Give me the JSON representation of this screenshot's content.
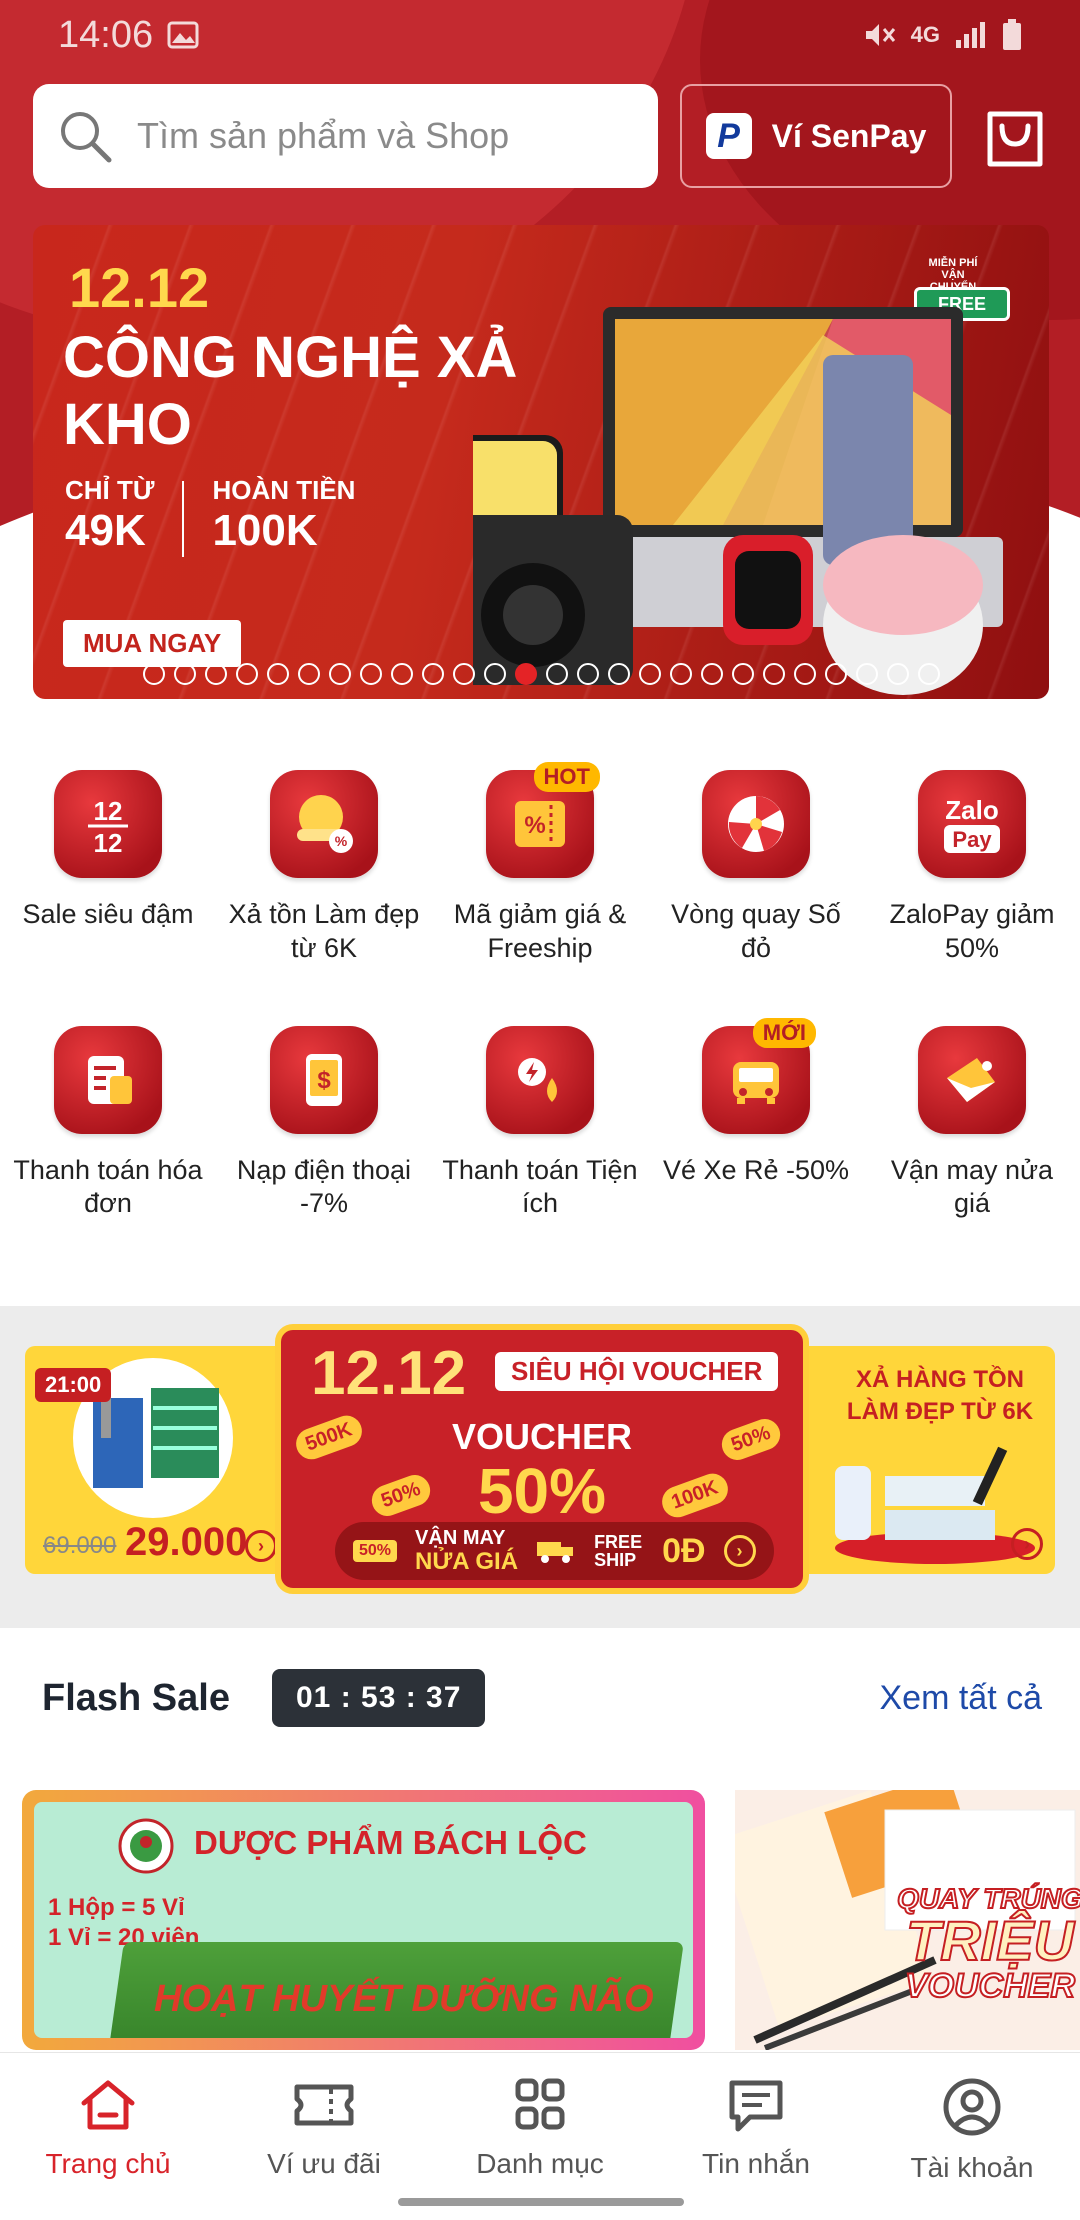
{
  "status_bar": {
    "time": "14:06",
    "network": "4G"
  },
  "search": {
    "placeholder": "Tìm sản phẩm và Shop"
  },
  "senpay": {
    "logo_letter": "P",
    "label": "Ví SenPay"
  },
  "banner": {
    "date": "12.12",
    "title": "CÔNG NGHỆ XẢ KHO",
    "col1_label": "CHỈ TỪ",
    "col1_value": "49K",
    "col2_label": "HOÀN TIỀN",
    "col2_value": "100K",
    "cta": "MUA NGAY",
    "free_ship_top": "MIỄN PHÍ VẬN CHUYỂN",
    "free_ship_badge": "FREE",
    "dot_count": 26,
    "active_dot": 13
  },
  "categories": [
    {
      "label": "Sale siêu đậm",
      "icon": "sale-1212-icon",
      "glyph": "12 12"
    },
    {
      "label": "Xả tồn Làm đẹp từ 6K",
      "icon": "beauty-clearance-icon",
      "glyph": "%"
    },
    {
      "label": "Mã giảm giá & Freeship",
      "icon": "coupon-icon",
      "glyph": "%",
      "badge": "HOT"
    },
    {
      "label": "Vòng quay Số đỏ",
      "icon": "lucky-wheel-icon",
      "glyph": "✣"
    },
    {
      "label": "ZaloPay giảm 50%",
      "icon": "zalopay-icon",
      "glyph": "Zalo Pay"
    },
    {
      "label": "Thanh toán hóa đơn",
      "icon": "bill-icon",
      "glyph": "≡"
    },
    {
      "label": "Nạp điện thoại -7%",
      "icon": "phone-topup-icon",
      "glyph": "$"
    },
    {
      "label": "Thanh toán Tiện ích",
      "icon": "utilities-icon",
      "glyph": "ϟ"
    },
    {
      "label": "Vé Xe Rẻ -50%",
      "icon": "bus-ticket-icon",
      "glyph": "▭",
      "badge": "MỚI"
    },
    {
      "label": "Vận may nửa giá",
      "icon": "half-price-luck-icon",
      "glyph": "◣"
    }
  ],
  "promo": {
    "time": "21:00",
    "old_price": "69.000",
    "new_price": "29.000",
    "center_date": "12.12",
    "center_tag": "SIÊU HỘI VOUCHER",
    "voucher_label": "VOUCHER",
    "voucher_pct": "50%",
    "luck_line1": "VẬN MAY",
    "luck_line2": "NỬA GIÁ",
    "ship_label": "FREE SHIP",
    "ship_value": "0Đ",
    "chip_500k": "500K",
    "chip_50": "50%",
    "chip_100k": "100K",
    "chip_50b": "50%",
    "chip_50c": "50%",
    "right_title": "XẢ HÀNG TỒN LÀM ĐẸP TỪ 6K"
  },
  "flash_sale": {
    "title": "Flash Sale",
    "timer": "01 : 53 : 37",
    "see_all": "Xem tất cả",
    "product1": {
      "brand": "DƯỢC PHẨM BÁCH LỘC",
      "line1": "1 Hộp = 5 Vỉ",
      "line2": "1 Vỉ = 20 viên",
      "box_text": "HOẠT HUYẾT DƯỠNG NÃO"
    },
    "product2": {
      "badge_a": "QUAY TRÚNG",
      "badge_b": "TRIỆU",
      "badge_c": "VOUCHER"
    }
  },
  "bottom_nav": [
    {
      "label": "Trang chủ",
      "icon": "home-icon",
      "active": true
    },
    {
      "label": "Ví ưu đãi",
      "icon": "ticket-icon"
    },
    {
      "label": "Danh mục",
      "icon": "grid-icon"
    },
    {
      "label": "Tin nhắn",
      "icon": "message-icon"
    },
    {
      "label": "Tài khoản",
      "icon": "account-icon"
    }
  ],
  "colors": {
    "brand_red": "#b31e25",
    "active_red": "#d8232a",
    "link_blue": "#1e4aa8"
  }
}
